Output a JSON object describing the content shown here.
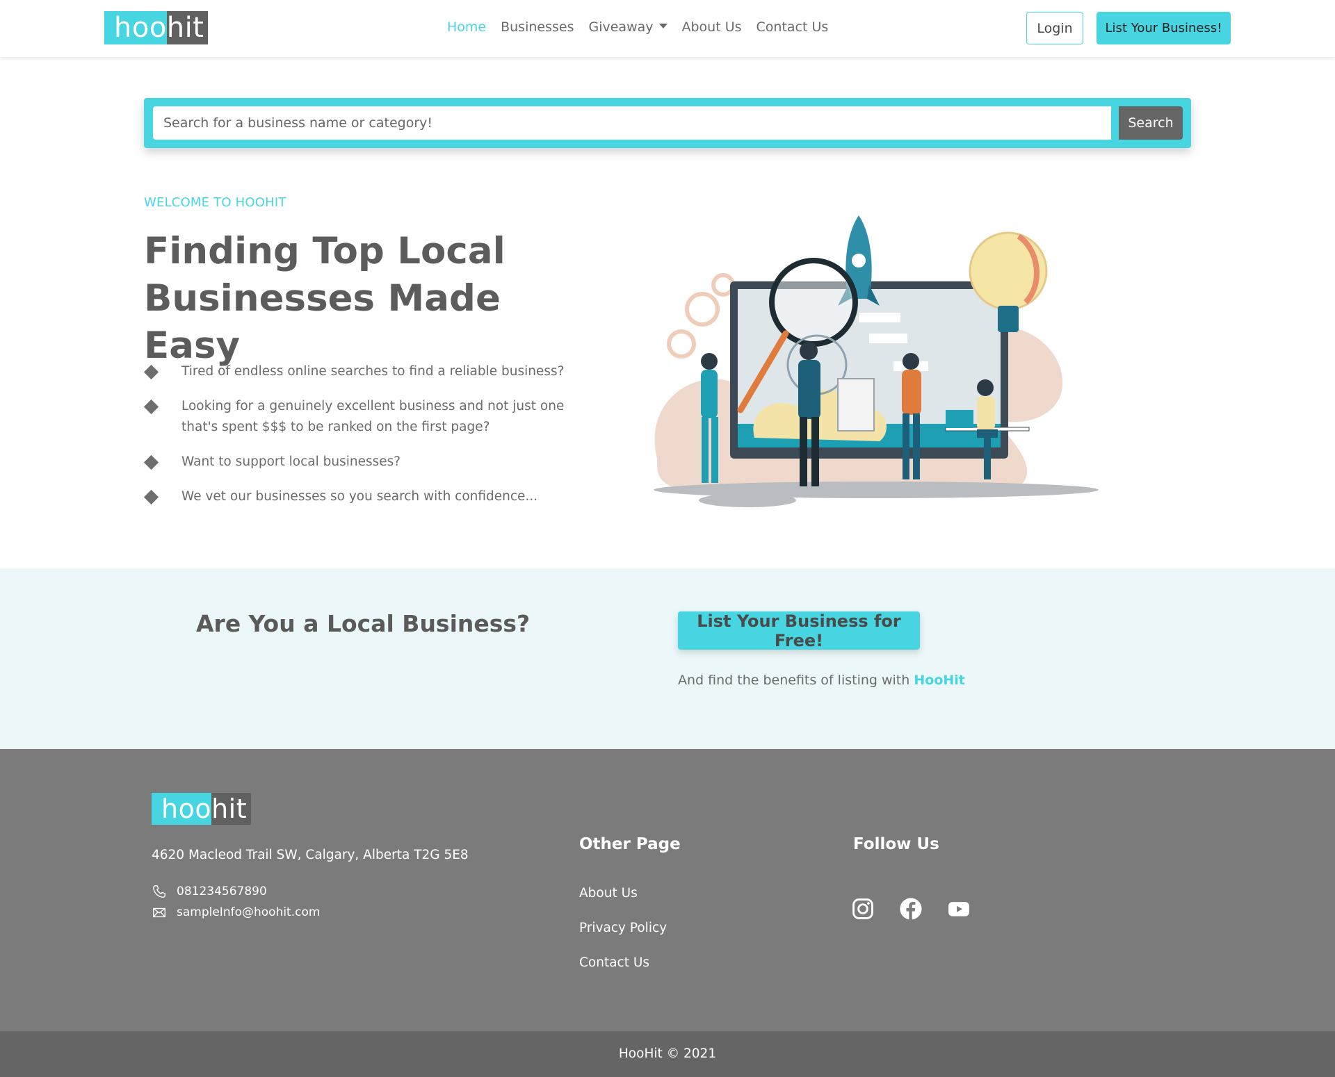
{
  "brand": {
    "logo_part1": "hoo",
    "logo_part2": "hit"
  },
  "nav": {
    "links": [
      "Home",
      "Businesses",
      "Giveaway",
      "About Us",
      "Contact Us"
    ],
    "active": "Home",
    "login_label": "Login",
    "list_label": "List Your Business!"
  },
  "search": {
    "placeholder": "Search for a business name or category!",
    "button_label": "Search"
  },
  "hero": {
    "eyebrow": "WELCOME TO HOOHIT",
    "title": "Finding Top Local Businesses Made Easy",
    "bullets": [
      "Tired of endless online searches to find a reliable business?",
      "Looking for a genuinely excellent business and not just one that's spent $$$ to be ranked on the first page?",
      "Want to support local businesses?",
      "We vet our businesses so you search with confidence..."
    ]
  },
  "cta": {
    "title": "Are You a Local Business?",
    "button_label": "List Your Business for Free!",
    "subtext": "And find the benefits of listing with",
    "subtext_brand": "HooHit"
  },
  "footer": {
    "address": "4620 Macleod Trail SW, Calgary, Alberta T2G 5E8",
    "phone": "081234567890",
    "email": "sampleInfo@hoohit.com",
    "other_page_heading": "Other Page",
    "other_links": [
      "About Us",
      "Privacy Policy",
      "Contact Us"
    ],
    "follow_heading": "Follow Us",
    "social_icons": [
      "instagram-icon",
      "facebook-icon",
      "youtube-icon"
    ],
    "copyright": "HooHit © 2021"
  },
  "colors": {
    "accent": "#48d5e2",
    "dark_gray": "#606060",
    "footer_bg": "#7b7b7b",
    "bottom_bar_bg": "#656565",
    "cta_bg": "#ebf7f8"
  }
}
